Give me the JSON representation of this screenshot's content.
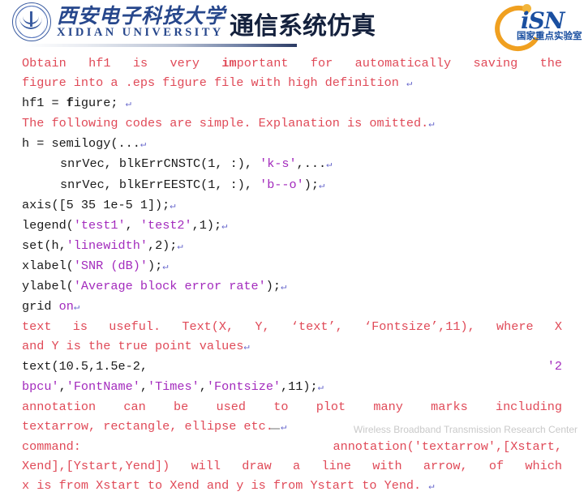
{
  "header": {
    "university_cn": "西安电子科技大学",
    "university_en": "XIDIAN UNIVERSITY",
    "slide_title": "通信系统仿真",
    "lab_logo_text": "iSN",
    "lab_logo_sub": "国家重点实验室"
  },
  "content": {
    "lines": [
      {
        "id": "l1",
        "justify": true,
        "segments": [
          {
            "text": "Obtain hf1 is very ",
            "style": "red"
          },
          {
            "text": "im",
            "style": "red-bold"
          },
          {
            "text": "portant for automatically saving the",
            "style": "red"
          }
        ]
      },
      {
        "id": "l2",
        "segments": [
          {
            "text": "figure into a .eps figure file with high definition ",
            "style": "red"
          },
          {
            "text": "↵",
            "style": "pilcrow"
          }
        ]
      },
      {
        "id": "l3",
        "segments": [
          {
            "text": "hf1 = ",
            "style": "dark"
          },
          {
            "text": "f",
            "style": "dark-bold"
          },
          {
            "text": "igure; ",
            "style": "dark"
          },
          {
            "text": "↵",
            "style": "pilcrow"
          }
        ]
      },
      {
        "id": "l4",
        "segments": [
          {
            "text": "The following codes are simple. Explanation is omitted.",
            "style": "red"
          },
          {
            "text": "↵",
            "style": "pilcrow"
          }
        ]
      },
      {
        "id": "l5",
        "segments": [
          {
            "text": "h = semilogy(...",
            "style": "dark"
          },
          {
            "text": "↵",
            "style": "pilcrow"
          }
        ]
      },
      {
        "id": "l6",
        "indent": true,
        "segments": [
          {
            "text": "snrVec, blkErrCNSTC(1, :), ",
            "style": "dark"
          },
          {
            "text": "'k-s'",
            "style": "str"
          },
          {
            "text": ",...",
            "style": "dark"
          },
          {
            "text": "↵",
            "style": "pilcrow"
          }
        ]
      },
      {
        "id": "l7",
        "indent": true,
        "segments": [
          {
            "text": "snrVec, blkErrEESTC(1, :), ",
            "style": "dark"
          },
          {
            "text": "'b--o'",
            "style": "str"
          },
          {
            "text": ");",
            "style": "dark"
          },
          {
            "text": "↵",
            "style": "pilcrow"
          }
        ]
      },
      {
        "id": "l8",
        "segments": [
          {
            "text": "axis([5 35 1e-5 1]);",
            "style": "dark"
          },
          {
            "text": "↵",
            "style": "pilcrow"
          }
        ]
      },
      {
        "id": "l9",
        "segments": [
          {
            "text": "legend(",
            "style": "dark"
          },
          {
            "text": "'test1'",
            "style": "str"
          },
          {
            "text": ", ",
            "style": "dark"
          },
          {
            "text": "'test2'",
            "style": "str"
          },
          {
            "text": ",1);",
            "style": "dark"
          },
          {
            "text": "↵",
            "style": "pilcrow"
          }
        ]
      },
      {
        "id": "l10",
        "segments": [
          {
            "text": "set(h,",
            "style": "dark"
          },
          {
            "text": "'linewidth'",
            "style": "str"
          },
          {
            "text": ",2);",
            "style": "dark"
          },
          {
            "text": "↵",
            "style": "pilcrow"
          }
        ]
      },
      {
        "id": "l11",
        "segments": [
          {
            "text": "xlabel(",
            "style": "dark"
          },
          {
            "text": "'SNR (dB)'",
            "style": "str"
          },
          {
            "text": ");",
            "style": "dark"
          },
          {
            "text": "↵",
            "style": "pilcrow"
          }
        ]
      },
      {
        "id": "l12",
        "segments": [
          {
            "text": "ylabel(",
            "style": "dark"
          },
          {
            "text": "'Average block error rate'",
            "style": "str"
          },
          {
            "text": ");",
            "style": "dark"
          },
          {
            "text": "↵",
            "style": "pilcrow"
          }
        ]
      },
      {
        "id": "l13",
        "segments": [
          {
            "text": "grid ",
            "style": "dark"
          },
          {
            "text": "on",
            "style": "str"
          },
          {
            "text": "↵",
            "style": "pilcrow"
          }
        ]
      },
      {
        "id": "l14",
        "justify": true,
        "segments": [
          {
            "text": "text is useful. Text(X, Y, ‘text’, ‘Fontsize’,11), where X",
            "style": "red"
          }
        ]
      },
      {
        "id": "l15",
        "segments": [
          {
            "text": "and Y is the true point values",
            "style": "red"
          },
          {
            "text": "↵",
            "style": "pilcrow"
          }
        ]
      },
      {
        "id": "l16",
        "justify": true,
        "segments": [
          {
            "text": "text(10.5,1.5e-2, ",
            "style": "dark"
          },
          {
            "text": "'2",
            "style": "str"
          }
        ]
      },
      {
        "id": "l17",
        "segments": [
          {
            "text": "bpcu'",
            "style": "str"
          },
          {
            "text": ",",
            "style": "dark"
          },
          {
            "text": "'FontName'",
            "style": "str"
          },
          {
            "text": ",",
            "style": "dark"
          },
          {
            "text": "'Times'",
            "style": "str"
          },
          {
            "text": ",",
            "style": "dark"
          },
          {
            "text": "'Fontsize'",
            "style": "str"
          },
          {
            "text": ",11);",
            "style": "dark"
          },
          {
            "text": "↵",
            "style": "pilcrow"
          }
        ]
      },
      {
        "id": "l18",
        "justify": true,
        "segments": [
          {
            "text": "annotation can be used to plot many marks including",
            "style": "red"
          }
        ]
      },
      {
        "id": "l19",
        "segments": [
          {
            "text": "textarrow, rectangle, ellipse etc. ",
            "style": "red"
          },
          {
            "text": "↵",
            "style": "pilcrow"
          }
        ]
      },
      {
        "id": "l20",
        "justify": true,
        "segments": [
          {
            "text": "command: annotation('textarrow',[Xstart,",
            "style": "red"
          }
        ]
      },
      {
        "id": "l21",
        "justify": true,
        "segments": [
          {
            "text": "Xend],[Ystart,Yend]) will draw a line with arrow, of which",
            "style": "red"
          }
        ]
      },
      {
        "id": "l22",
        "segments": [
          {
            "text": "x is from Xstart to Xend and y is from Ystart to Yend. ",
            "style": "red"
          },
          {
            "text": "↵",
            "style": "pilcrow"
          }
        ]
      }
    ]
  },
  "footer": {
    "text": "Wireless Broadband Transmission Research Center"
  },
  "colors": {
    "red": "#e04a58",
    "dark": "#1a1a1a",
    "string": "#a32bbd",
    "brand_blue": "#27478c",
    "accent_orange": "#f0a020"
  }
}
